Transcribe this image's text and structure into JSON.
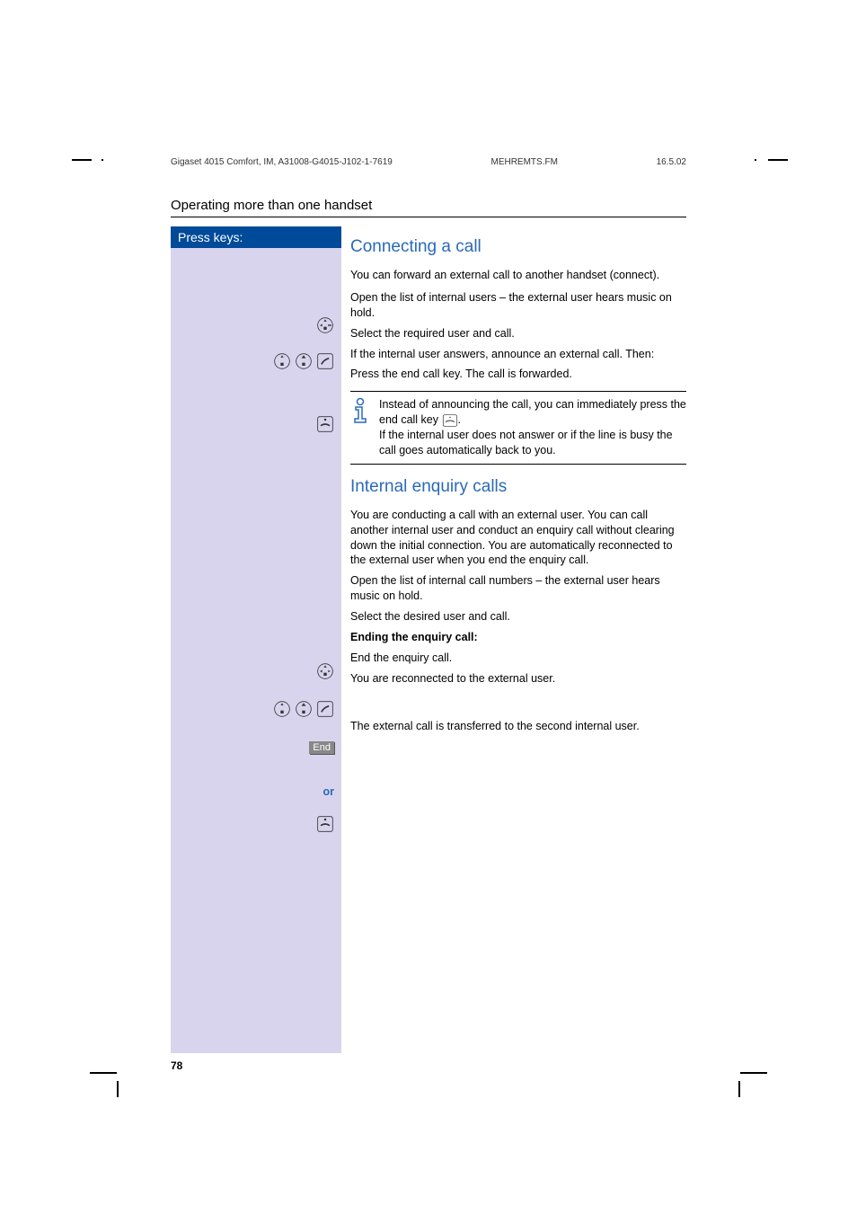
{
  "header": {
    "left": "Gigaset 4015 Comfort, IM, A31008-G4015-J102-1-7619",
    "center": "MEHREMTS.FM",
    "right": "16.5.02"
  },
  "section_title": "Operating more than one handset",
  "left_label": "Press keys:",
  "h2_connecting": "Connecting a call",
  "p_forward": "You can forward an external call to another handset (connect).",
  "p_open_list": "Open the list of internal users – the external user hears music on hold.",
  "p_select_user": "Select the required user and call.",
  "p_announce": "If the internal user answers, announce an external call. Then:",
  "p_press_end": "Press the end call key. The call is forwarded.",
  "info_line1": "Instead of announcing the call, you can immediately press the end call key",
  "info_line2": ".",
  "info_line3": "If the internal user does not answer or if the line is busy the call goes automatically back to you.",
  "h2_internal": "Internal enquiry calls",
  "p_conducting": "You are conducting a call with an external user. You can call another internal user and conduct an enquiry call without clearing down the initial connection. You are automatically reconnected to the external user when you end the enquiry call.",
  "p_open_list2": "Open the list of internal call numbers – the external user hears music on hold.",
  "p_select_desired": "Select the desired user and call.",
  "p_ending_bold": "Ending the enquiry call:",
  "p_end_enquiry": "End the enquiry call.",
  "p_reconnected": "You are reconnected to the external user.",
  "or_label": "or",
  "p_transferred": "The external call is transferred to the second internal user.",
  "end_badge": "End",
  "page_number": "78"
}
